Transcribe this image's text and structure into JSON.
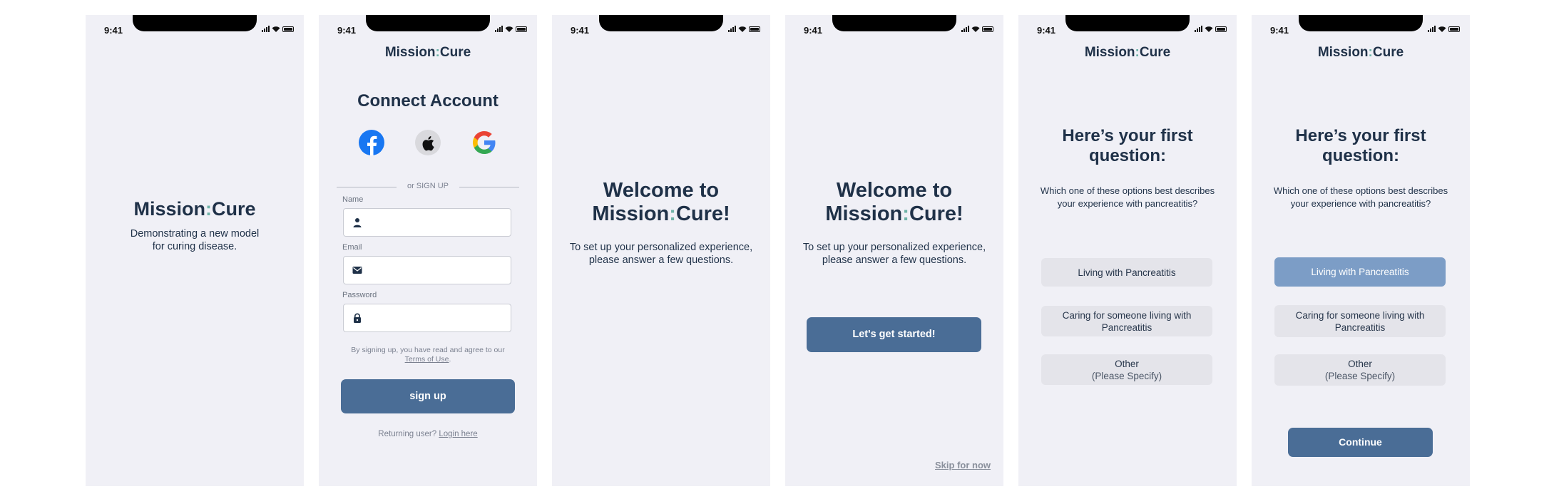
{
  "status": {
    "time": "9:41"
  },
  "brand": {
    "mission": "Mission",
    "colon": ":",
    "cure": "Cure"
  },
  "splash": {
    "tagline_1": "Demonstrating a new model",
    "tagline_2": "for curing disease."
  },
  "connect": {
    "title": "Connect Account",
    "social": [
      "Facebook",
      "Apple",
      "Google"
    ],
    "divider": "or SIGN UP",
    "name_label": "Name",
    "email_label": "Email",
    "password_label": "Password",
    "terms_prefix": "By signing up, you have read and agree to our",
    "terms_link": "Terms of Use",
    "terms_suffix": ".",
    "signup_button": "sign up",
    "returning": "Returning user?",
    "login_link": "Login here"
  },
  "welcome": {
    "title_1": "Welcome to",
    "title_2_mission": "Mission",
    "title_2_colon": ":",
    "title_2_cure": "Cure!",
    "sub_1": "To set up your personalized experience,",
    "sub_2": "please answer a few questions.",
    "start_button": "Let's get started!",
    "skip_link": "Skip for now"
  },
  "question": {
    "title_1": "Here’s your first",
    "title_2": "question:",
    "prompt_1": "Which one of these options best describes",
    "prompt_2": "your experience with pancreatitis?",
    "options": [
      {
        "line1": "Living with Pancreatitis"
      },
      {
        "line1": "Caring for someone living with",
        "line2": "Pancreatitis"
      },
      {
        "line1": "Other",
        "line2": "(Please Specify)"
      }
    ],
    "continue_button": "Continue"
  },
  "colors": {
    "background": "#f0f0f6",
    "primary": "#4a6d96",
    "selected": "#7c9dc6",
    "accent": "#6fb3a8",
    "text": "#1f3148"
  }
}
